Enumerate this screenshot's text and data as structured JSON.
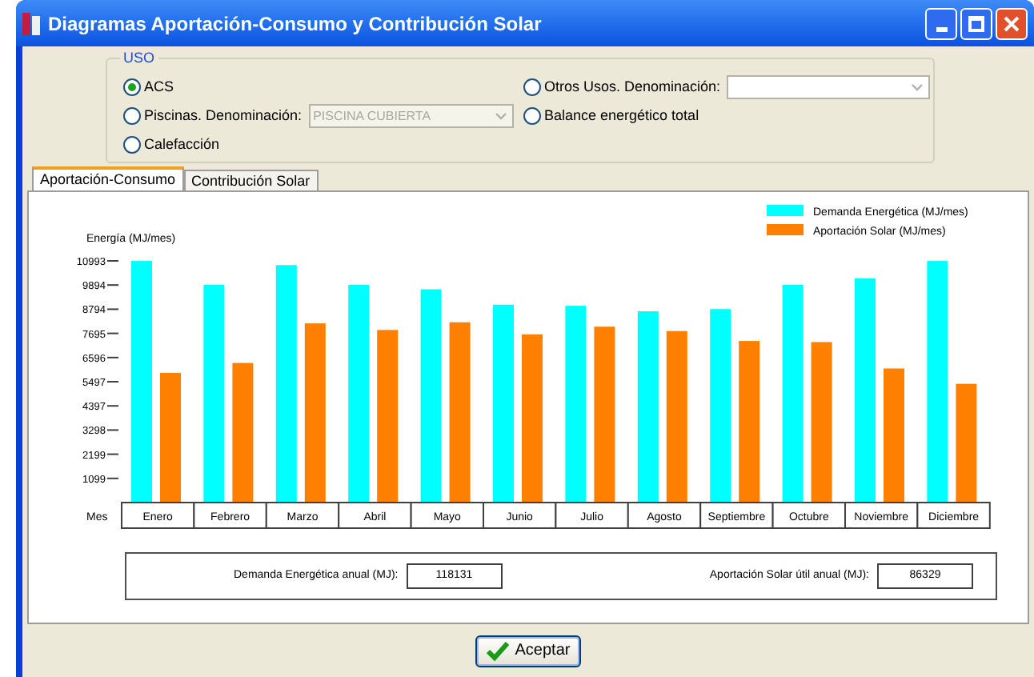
{
  "window": {
    "title": "Diagramas Aportación-Consumo y Contribución Solar"
  },
  "uso": {
    "title": "USO",
    "left_options": [
      {
        "label": "ACS",
        "selected": true,
        "kind": "plain"
      },
      {
        "label": "Piscinas. Denominación:",
        "selected": false,
        "kind": "select",
        "field": {
          "value": "PISCINA CUBIERTA",
          "disabled": true
        }
      },
      {
        "label": "Calefacción",
        "selected": false,
        "kind": "plain"
      }
    ],
    "right_options": [
      {
        "label": "Otros Usos. Denominación:",
        "selected": false,
        "kind": "select",
        "field": {
          "disabled": false
        }
      },
      {
        "label": "Balance energético total",
        "selected": false,
        "kind": "plain"
      }
    ]
  },
  "tabs": [
    {
      "label": "Aportación-Consumo",
      "selected": true
    },
    {
      "label": "Contribución Solar",
      "selected": false
    }
  ],
  "chart_data": {
    "type": "bar",
    "ylabel": "Energía (MJ/mes)",
    "xlabel": "Mes",
    "categories": [
      "Enero",
      "Febrero",
      "Marzo",
      "Abril",
      "Mayo",
      "Junio",
      "Julio",
      "Agosto",
      "Septiembre",
      "Octubre",
      "Noviembre",
      "Diciembre"
    ],
    "series": [
      {
        "name": "Demanda Energética (MJ/mes)",
        "color": "#00ffff",
        "values": [
          10990,
          9900,
          10800,
          9900,
          9700,
          9000,
          8950,
          8700,
          8800,
          9900,
          10200,
          10990
        ]
      },
      {
        "name": "Aportación Solar (MJ/mes)",
        "color": "#ff8000",
        "values": [
          5900,
          6350,
          8150,
          7850,
          8200,
          7650,
          8000,
          7800,
          7350,
          7300,
          6100,
          5400
        ]
      }
    ],
    "legend": true,
    "ylim": [
      0,
      10993
    ],
    "yticks": [
      1099,
      2199,
      3298,
      4397,
      5497,
      6596,
      7695,
      8794,
      9894,
      10993
    ]
  },
  "totals": [
    {
      "label": "Demanda Energética anual (MJ):",
      "value": "118131"
    },
    {
      "label": "Aportación Solar útil anual (MJ):",
      "value": "86329"
    }
  ],
  "button": {
    "label": "Aceptar"
  }
}
